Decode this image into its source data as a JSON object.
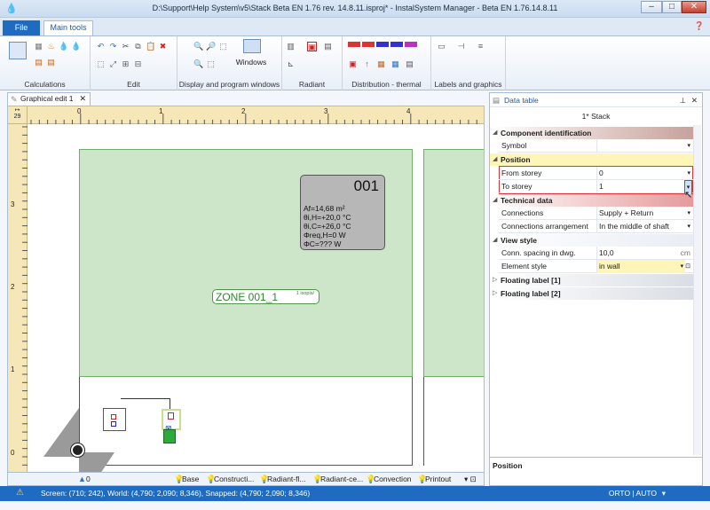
{
  "window": {
    "title": "D:\\Support\\Help System\\v5\\Stack Beta EN 1.76 rev. 14.8.11.isproj* - InstalSystem Manager - Beta EN 1.76.14.8.11",
    "minimize": "–",
    "maximize": "□",
    "close": "✕"
  },
  "ribbon_tabs": {
    "file": "File",
    "main": "Main tools"
  },
  "ribbon_groups": {
    "calculations": "Calculations",
    "edit": "Edit",
    "display": "Display and program windows",
    "windows_btn": "Windows",
    "radiant": "Radiant",
    "distribution": "Distribution - thermal",
    "labels": "Labels and graphics"
  },
  "doc_tab": {
    "label": "Graphical edit 1",
    "close": "✕"
  },
  "ruler": {
    "corner": "29",
    "h_ticks": [
      "0",
      "1",
      "2",
      "3",
      "4"
    ],
    "v_ticks": [
      "3",
      "2",
      "1",
      "0"
    ]
  },
  "drawing": {
    "room_number": "001",
    "room_lines": [
      "Af=14,68 m²",
      "θi,H=+20,0 °C",
      "θi,C=+26,0 °C",
      "Φreq,H=0 W",
      "ΦC=??? W"
    ],
    "zone_label": "ZONE 001_1",
    "zone_label_small": "1 isopis/"
  },
  "bottom_tabs": {
    "level": "0",
    "tabs": [
      "Base",
      "Constructi...",
      "Radiant-fl...",
      "Radiant-ce...",
      "Convection",
      "Printout"
    ]
  },
  "status": {
    "text": "Screen: (710; 242), World: (4,790; 2,090; 8,346), Snapped: (4,790; 2,090; 8,346)",
    "mode": "ORTO | AUTO"
  },
  "data_table": {
    "title": "Data table",
    "object": "1* Stack",
    "categories": {
      "component": "Component identification",
      "position": "Position",
      "technical": "Technical data",
      "view": "View style",
      "float1": "Floating label [1]",
      "float2": "Floating label [2]"
    },
    "rows": {
      "symbol": {
        "k": "Symbol",
        "v": ""
      },
      "from_storey": {
        "k": "From storey",
        "v": "0"
      },
      "to_storey": {
        "k": "To storey",
        "v": "1"
      },
      "connections": {
        "k": "Connections",
        "v": "Supply + Return"
      },
      "conn_arr": {
        "k": "Connections arrangement",
        "v": "In the middle of shaft"
      },
      "spacing": {
        "k": "Conn. spacing in dwg.",
        "v": "10,0",
        "unit": "cm"
      },
      "element_style": {
        "k": "Element style",
        "v": "in wall"
      }
    },
    "description": "Position"
  },
  "colors": {
    "accent": "#1f6bc2",
    "zone": "#cde6c9",
    "highlight": "#fdf6b8"
  }
}
